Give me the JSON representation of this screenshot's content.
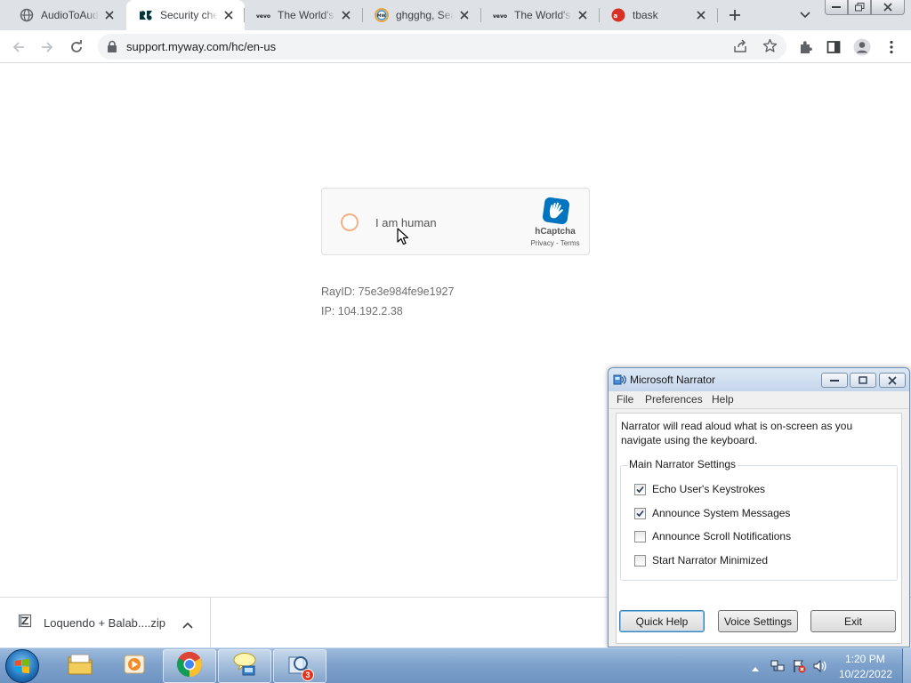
{
  "browser": {
    "tabs": [
      {
        "title": "AudioToAudio",
        "favicon": "globe-icon",
        "active": false
      },
      {
        "title": "Security check",
        "favicon": "zendesk-icon",
        "active": true
      },
      {
        "title": "The World's Largest",
        "favicon": "vevo-icon",
        "active": false
      },
      {
        "title": "ghgghg, Search",
        "favicon": "myway-icon",
        "active": false
      },
      {
        "title": "The World's Largest",
        "favicon": "vevo-icon",
        "active": false
      },
      {
        "title": "tbask",
        "favicon": "ask-icon",
        "active": false
      }
    ],
    "url": "support.myway.com/hc/en-us"
  },
  "captcha": {
    "label": "I am human",
    "brand": "hCaptcha",
    "privacy": "Privacy",
    "separator": " - ",
    "terms": "Terms",
    "checked": false
  },
  "page": {
    "ray_id": "RayID: 75e3e984fe9e1927",
    "ip": "IP: 104.192.2.38"
  },
  "download": {
    "filename": "Loquendo + Balab....zip"
  },
  "narrator": {
    "title": "Microsoft Narrator",
    "menu": [
      "File",
      "Preferences",
      "Help"
    ],
    "description": "Narrator will read aloud what is on-screen as you navigate using the keyboard.",
    "group_title": "Main Narrator Settings",
    "options": [
      {
        "label": "Echo User's Keystrokes",
        "checked": true
      },
      {
        "label": "Announce System Messages",
        "checked": true
      },
      {
        "label": "Announce Scroll Notifications",
        "checked": false
      },
      {
        "label": "Start Narrator Minimized",
        "checked": false
      }
    ],
    "buttons": {
      "quick_help": "Quick Help",
      "voice_settings": "Voice Settings",
      "exit": "Exit"
    }
  },
  "taskbar": {
    "badge_count": "3",
    "time": "1:20 PM",
    "date": "10/22/2022"
  },
  "colors": {
    "captcha_circle": "#f4b183",
    "hcaptcha_logo": "#0074bf",
    "taskbar": "#7ea2cc"
  }
}
